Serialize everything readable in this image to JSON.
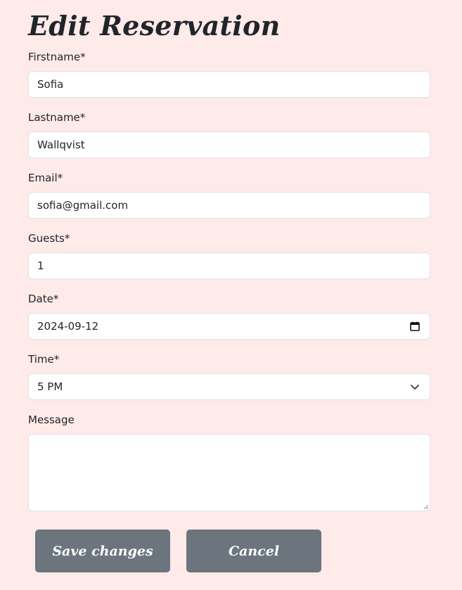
{
  "page": {
    "title": "Edit Reservation"
  },
  "form": {
    "firstname": {
      "label": "Firstname*",
      "value": "Sofia"
    },
    "lastname": {
      "label": "Lastname*",
      "value": "Wallqvist"
    },
    "email": {
      "label": "Email*",
      "value": "sofia@gmail.com"
    },
    "guests": {
      "label": "Guests*",
      "value": "1"
    },
    "date": {
      "label": "Date*",
      "value": "2024-09-12",
      "icon": "calendar-icon"
    },
    "time": {
      "label": "Time*",
      "value": "5 PM",
      "icon": "chevron-down-icon"
    },
    "message": {
      "label": "Message",
      "value": ""
    }
  },
  "actions": {
    "save_label": "Save changes",
    "cancel_label": "Cancel"
  },
  "colors": {
    "background": "#ffeaea",
    "button": "#6c757d",
    "input_border": "#dee2e6"
  }
}
